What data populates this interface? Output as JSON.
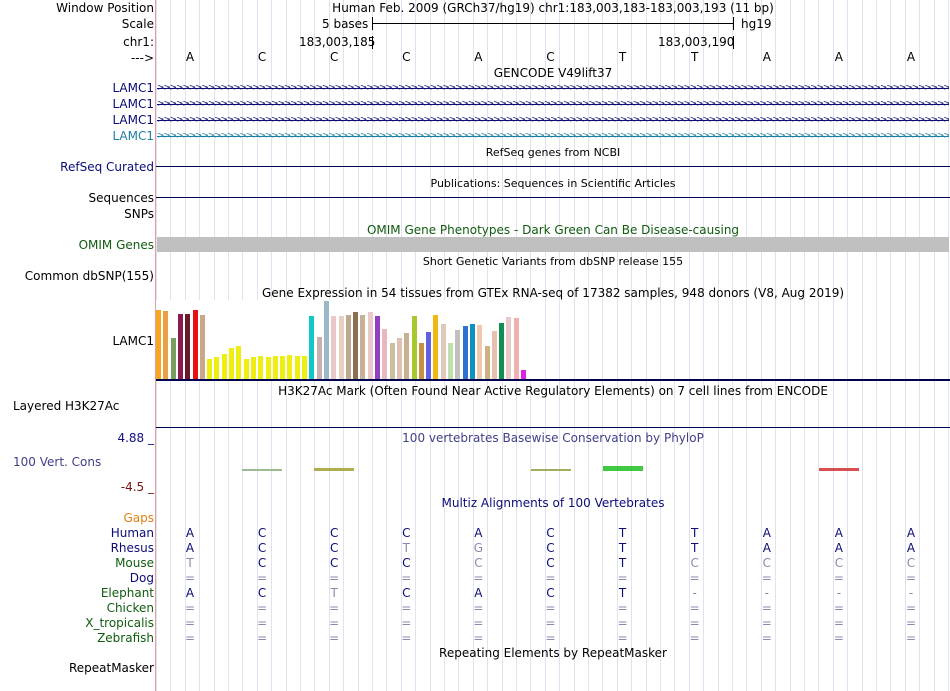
{
  "header": {
    "window_position_label": "Window Position",
    "scale_label": "Scale",
    "chr_label": "chr1:",
    "arrow_label": "--->",
    "assembly_title": "Human Feb. 2009 (GRCh37/hg19)   chr1:183,003,183-183,003,193 (11 bp)",
    "scale_text": "5 bases",
    "scale_db": "hg19",
    "pos_left": "183,003,185",
    "pos_right": "183,003,190"
  },
  "sequence": [
    "A",
    "C",
    "C",
    "C",
    "A",
    "C",
    "T",
    "T",
    "A",
    "A",
    "A"
  ],
  "gencode": {
    "title": "GENCODE V49lift37",
    "transcripts": [
      {
        "label": "LAMC1",
        "color": "#0c0c78"
      },
      {
        "label": "LAMC1",
        "color": "#0c0c78"
      },
      {
        "label": "LAMC1",
        "color": "#0c0c78"
      },
      {
        "label": "LAMC1",
        "color": "#1e7fa4"
      }
    ]
  },
  "refseq": {
    "label": "RefSeq Curated",
    "title": "RefSeq genes from NCBI"
  },
  "publications": {
    "label": "Sequences",
    "title": "Publications: Sequences in Scientific Articles"
  },
  "snps": {
    "label": "SNPs"
  },
  "omim": {
    "label": "OMIM Genes",
    "title": "OMIM Gene Phenotypes - Dark Green Can Be Disease-causing",
    "color": "#0f5c0f"
  },
  "dbsnp": {
    "label": "Common dbSNP(155)",
    "title": "Short Genetic Variants from dbSNP release 155"
  },
  "gtex": {
    "label": "LAMC1",
    "title": "Gene Expression in 54 tissues from GTEx RNA-seq of 17382 samples, 948 donors (V8, Aug 2019)",
    "bars": [
      {
        "v": 0.99,
        "c": "#f5a623"
      },
      {
        "v": 0.97,
        "c": "#e8a040"
      },
      {
        "v": 0.58,
        "c": "#77a060"
      },
      {
        "v": 0.93,
        "c": "#8b1a4a"
      },
      {
        "v": 0.93,
        "c": "#6b1a2a"
      },
      {
        "v": 0.99,
        "c": "#e81010"
      },
      {
        "v": 0.91,
        "c": "#c8a888"
      },
      {
        "v": 0.28,
        "c": "#eeee10"
      },
      {
        "v": 0.31,
        "c": "#eeee10"
      },
      {
        "v": 0.36,
        "c": "#eeee10"
      },
      {
        "v": 0.44,
        "c": "#eeee10"
      },
      {
        "v": 0.47,
        "c": "#eeee10"
      },
      {
        "v": 0.28,
        "c": "#eeee10"
      },
      {
        "v": 0.31,
        "c": "#eeee10"
      },
      {
        "v": 0.33,
        "c": "#eeee10"
      },
      {
        "v": 0.31,
        "c": "#eeee10"
      },
      {
        "v": 0.33,
        "c": "#eeee10"
      },
      {
        "v": 0.33,
        "c": "#eeee10"
      },
      {
        "v": 0.34,
        "c": "#eeee10"
      },
      {
        "v": 0.33,
        "c": "#eeee10"
      },
      {
        "v": 0.33,
        "c": "#eeee10"
      },
      {
        "v": 0.9,
        "c": "#10c8c8"
      },
      {
        "v": 0.6,
        "c": "#c8b0b0"
      },
      {
        "v": 1.11,
        "c": "#9ab8c8"
      },
      {
        "v": 0.9,
        "c": "#e8c8c8"
      },
      {
        "v": 0.9,
        "c": "#e8d0c0"
      },
      {
        "v": 0.91,
        "c": "#c0a890"
      },
      {
        "v": 0.96,
        "c": "#8a7050"
      },
      {
        "v": 0.91,
        "c": "#c8b098"
      },
      {
        "v": 0.96,
        "c": "#e8c8c8"
      },
      {
        "v": 0.9,
        "c": "#9040c0"
      },
      {
        "v": 0.71,
        "c": "#e8b8c0"
      },
      {
        "v": 0.51,
        "c": "#c8c0a0"
      },
      {
        "v": 0.59,
        "c": "#e0c0b0"
      },
      {
        "v": 0.66,
        "c": "#c8b090"
      },
      {
        "v": 0.9,
        "c": "#a8c830"
      },
      {
        "v": 0.51,
        "c": "#c89040"
      },
      {
        "v": 0.67,
        "c": "#6060e0"
      },
      {
        "v": 0.91,
        "c": "#f0b810"
      },
      {
        "v": 0.79,
        "c": "#e0c8b8"
      },
      {
        "v": 0.51,
        "c": "#c0e0b0"
      },
      {
        "v": 0.7,
        "c": "#c0c0c0"
      },
      {
        "v": 0.76,
        "c": "#3070d0"
      },
      {
        "v": 0.79,
        "c": "#1090c0"
      },
      {
        "v": 0.77,
        "c": "#f0c8b0"
      },
      {
        "v": 0.47,
        "c": "#d0b080"
      },
      {
        "v": 0.69,
        "c": "#e8c0b0"
      },
      {
        "v": 0.8,
        "c": "#109050"
      },
      {
        "v": 0.89,
        "c": "#e8c8c8"
      },
      {
        "v": 0.87,
        "c": "#f0b0b0"
      },
      {
        "v": 0.13,
        "c": "#e020e0"
      }
    ]
  },
  "h3k27ac": {
    "label": "Layered H3K27Ac",
    "title": "H3K27Ac Mark (Often Found Near Active Regulatory Elements) on 7 cell lines from ENCODE"
  },
  "phylop": {
    "label": "100 Vert. Cons",
    "max_label": "4.88 _",
    "min_label": "-4.5 _",
    "title": "100 vertebrates Basewise Conservation by PhyloP",
    "max_color": "#101080",
    "min_color": "#801010",
    "values": [
      0,
      0.08,
      0.14,
      0,
      0,
      0.09,
      0.35,
      0,
      0,
      -0.15,
      0
    ],
    "colors": [
      "#8ab080",
      "#8ab080",
      "#a0a030",
      "#8ab080",
      "#8ab080",
      "#90a040",
      "#20c020",
      "#8ab080",
      "#8ab080",
      "#d03030",
      "#8ab080"
    ]
  },
  "multiz": {
    "title": "Multiz Alignments of 100 Vertebrates",
    "gaps_label": "Gaps",
    "gaps_color": "#e08010",
    "rows": [
      {
        "label": "Human",
        "color": "#0c0c78",
        "bases": [
          "A",
          "C",
          "C",
          "C",
          "A",
          "C",
          "T",
          "T",
          "A",
          "A",
          "A"
        ]
      },
      {
        "label": "Rhesus",
        "color": "#0c0c78",
        "bases": [
          "A",
          "C",
          "C",
          "T",
          "G",
          "C",
          "T",
          "T",
          "A",
          "A",
          "A"
        ],
        "faded": [
          3,
          4
        ]
      },
      {
        "label": "Mouse",
        "color": "#0f5c0f",
        "bases": [
          "T",
          "C",
          "C",
          "C",
          "C",
          "C",
          "T",
          "C",
          "C",
          "C",
          "C"
        ],
        "faded": [
          0,
          4,
          7,
          8,
          9,
          10
        ]
      },
      {
        "label": "Dog",
        "color": "#0c0c78",
        "bases": [
          "=",
          "=",
          "=",
          "=",
          "=",
          "=",
          "=",
          "=",
          "=",
          "=",
          "="
        ]
      },
      {
        "label": "Elephant",
        "color": "#0f5c0f",
        "bases": [
          "A",
          "C",
          "T",
          "C",
          "A",
          "C",
          "T",
          "-",
          "-",
          "-",
          "-"
        ],
        "faded": [
          2
        ]
      },
      {
        "label": "Chicken",
        "color": "#0f5c0f",
        "bases": [
          "=",
          "=",
          "=",
          "=",
          "=",
          "=",
          "=",
          "=",
          "=",
          "=",
          "="
        ]
      },
      {
        "label": "X_tropicalis",
        "color": "#0f5c0f",
        "bases": [
          "=",
          "=",
          "=",
          "=",
          "=",
          "=",
          "=",
          "=",
          "=",
          "=",
          "="
        ]
      },
      {
        "label": "Zebrafish",
        "color": "#0f5c0f",
        "bases": [
          "=",
          "=",
          "=",
          "=",
          "=",
          "=",
          "=",
          "=",
          "=",
          "=",
          "="
        ]
      }
    ]
  },
  "repeatmasker": {
    "label": "RepeatMasker",
    "title": "Repeating Elements by RepeatMasker"
  },
  "colors": {
    "track_dark": "#000050",
    "omim_bar": "#c0c0c0",
    "phylop_title": "#40408a"
  }
}
